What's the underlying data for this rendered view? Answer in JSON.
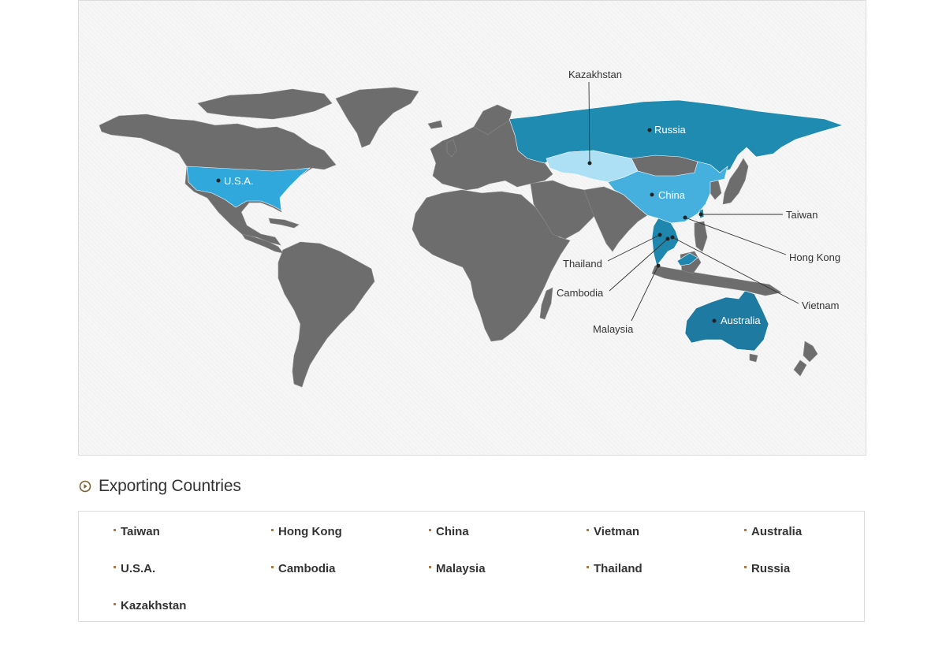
{
  "colors": {
    "land": "#6d6d6d",
    "russia": "#1f8bb0",
    "kazakhstan": "#aee0f5",
    "china": "#45b0de",
    "usa": "#31a8dc",
    "australia": "#1e7aa0",
    "se_asia": "#1f86ad",
    "bullet": "#a47c4a",
    "title_icon": "#7a6130"
  },
  "map": {
    "labels": {
      "kazakhstan": "Kazakhstan",
      "russia": "Russia",
      "usa": "U.S.A.",
      "china": "China",
      "taiwan": "Taiwan",
      "hongkong": "Hong Kong",
      "thailand": "Thailand",
      "cambodia": "Cambodia",
      "malaysia": "Malaysia",
      "vietnam": "Vietnam",
      "australia": "Australia"
    }
  },
  "section": {
    "icon": "circle-play-icon",
    "title": "Exporting Countries"
  },
  "countries": [
    "Taiwan",
    "Hong Kong",
    "China",
    "Vietman",
    "Australia",
    "U.S.A.",
    "Cambodia",
    "Malaysia",
    "Thailand",
    "Russia",
    "Kazakhstan"
  ]
}
